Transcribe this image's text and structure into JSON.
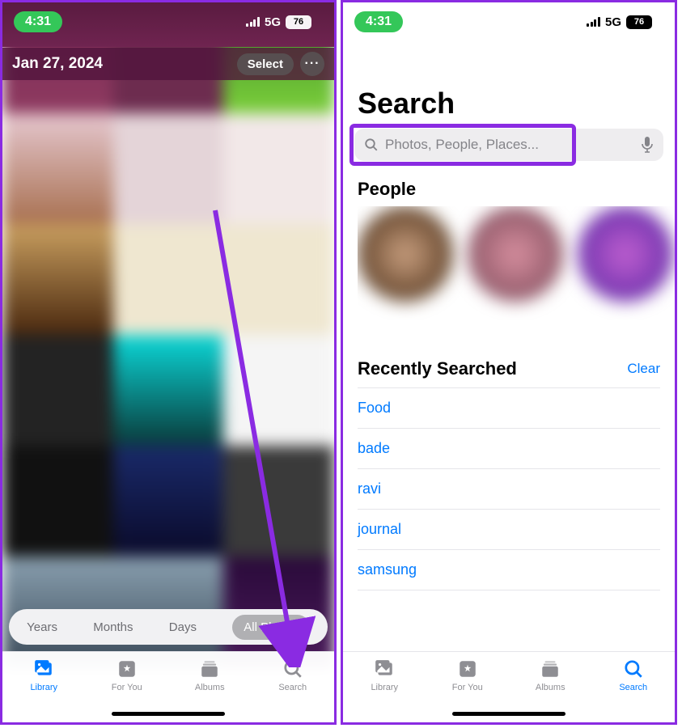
{
  "status": {
    "time": "4:31",
    "network": "5G",
    "battery": "76"
  },
  "left": {
    "date": "Jan 27, 2024",
    "select": "Select",
    "filters": {
      "years": "Years",
      "months": "Months",
      "days": "Days",
      "all": "All Photos"
    }
  },
  "right": {
    "title": "Search",
    "placeholder": "Photos, People, Places...",
    "people_header": "People",
    "recent_header": "Recently Searched",
    "clear": "Clear",
    "recent": [
      "Food",
      "bade",
      "ravi",
      "journal",
      "samsung"
    ]
  },
  "tabs": {
    "library": "Library",
    "foryou": "For You",
    "albums": "Albums",
    "search": "Search"
  }
}
